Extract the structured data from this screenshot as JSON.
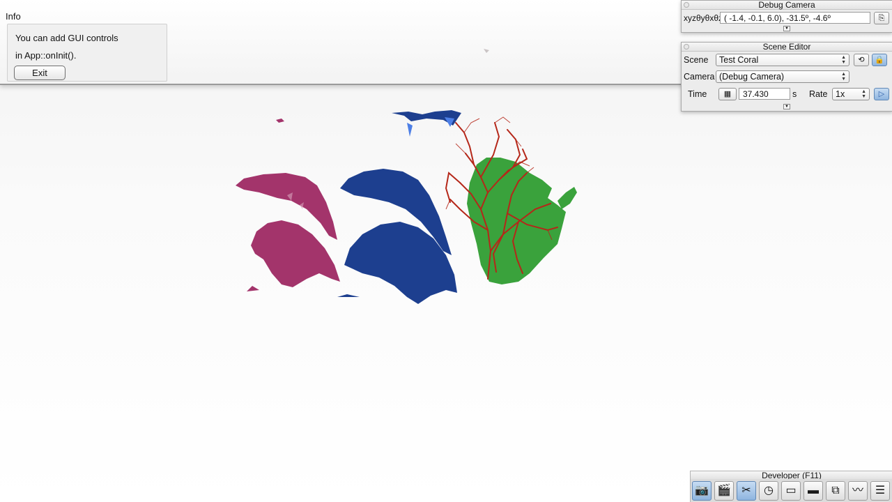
{
  "info": {
    "title": "Info",
    "line1": "You can add GUI controls",
    "line2": "in App::onInit().",
    "exit_label": "Exit"
  },
  "debug_camera": {
    "title": "Debug Camera",
    "label": "xyzθyθxθz",
    "value": "( -1.4,  -0.1,   6.0), -31.5º,  -4.6º",
    "icon": "copy-icon"
  },
  "scene_editor": {
    "title": "Scene Editor",
    "scene_label": "Scene",
    "scene_value": "Test Coral",
    "camera_label": "Camera",
    "camera_value": "(Debug Camera)",
    "time_label": "Time",
    "time_value": "37.430",
    "time_unit": "s",
    "rate_label": "Rate",
    "rate_value": "1x"
  },
  "developer": {
    "title": "Developer (F11)",
    "buttons": [
      {
        "icon": "camera-icon",
        "active": true
      },
      {
        "icon": "clapperboard-icon",
        "active": false
      },
      {
        "icon": "tools-icon",
        "active": true
      },
      {
        "icon": "clock-icon",
        "active": false
      },
      {
        "icon": "new-window-icon",
        "active": false
      },
      {
        "icon": "console-icon",
        "active": false
      },
      {
        "icon": "windows-icon",
        "active": false
      },
      {
        "icon": "graph-icon",
        "active": false
      },
      {
        "icon": "log-icon",
        "active": false
      }
    ]
  },
  "colors": {
    "coral_pink": "#a3346b",
    "coral_blue": "#1d3f8f",
    "coral_red": "#b52719",
    "coral_green": "#3aa23c",
    "accent_blue": "#8fb5df"
  }
}
